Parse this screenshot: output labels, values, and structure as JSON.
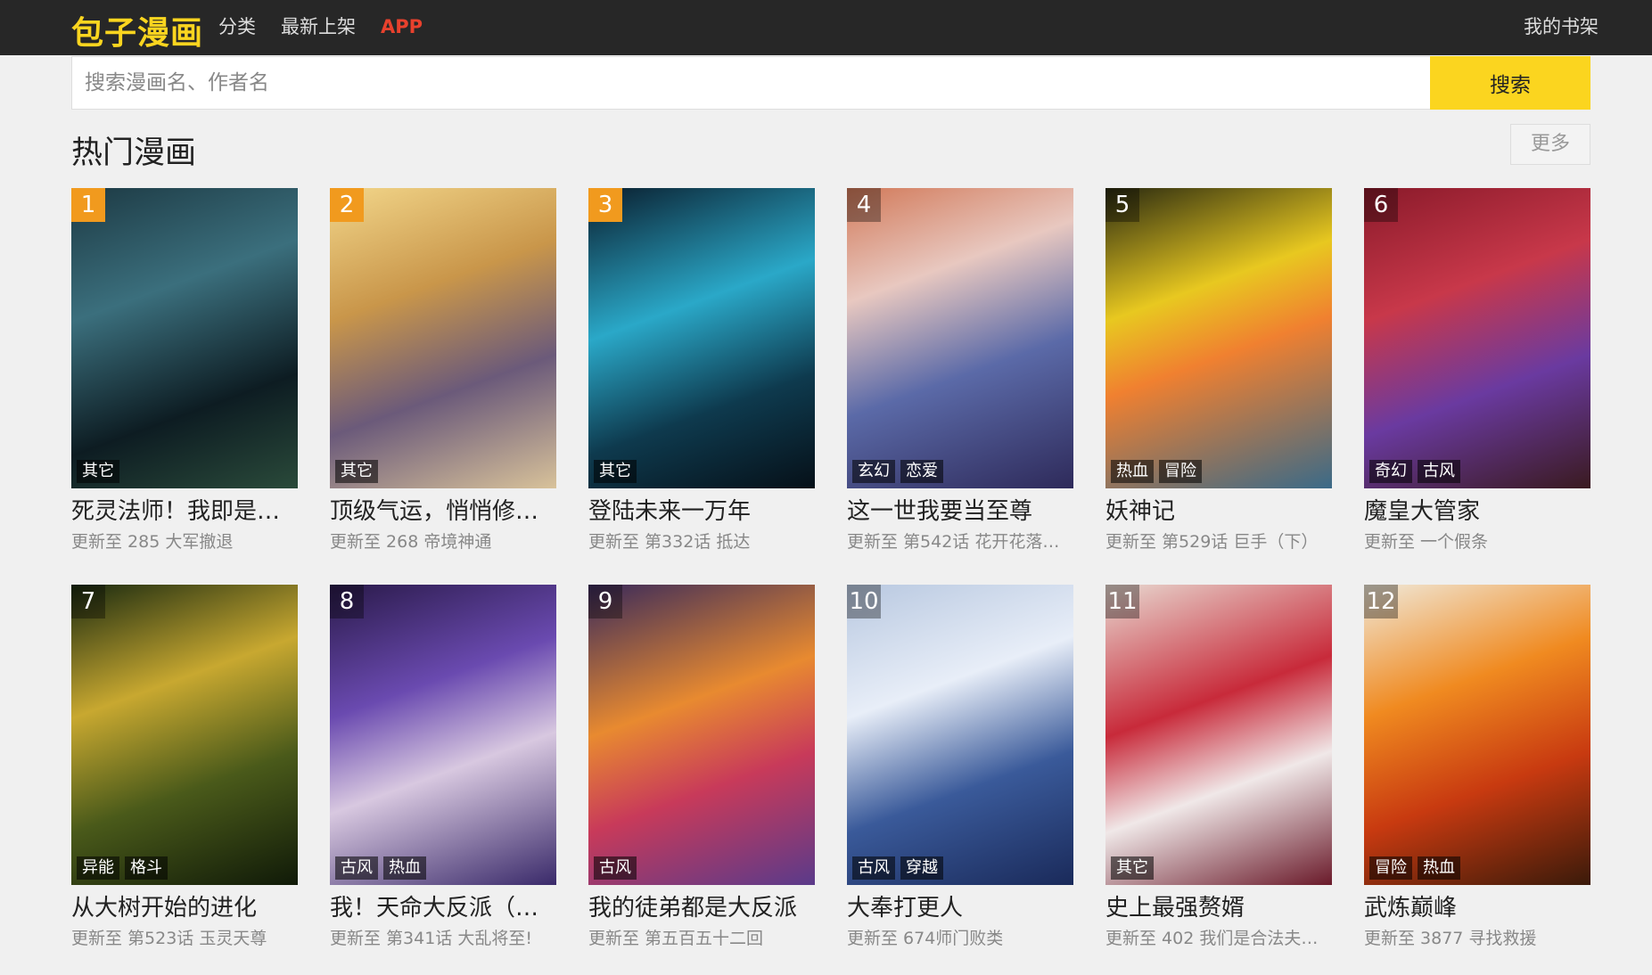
{
  "header": {
    "logo": "包子漫画",
    "nav": [
      "分类",
      "最新上架",
      "APP"
    ],
    "shelf": "我的书架"
  },
  "search": {
    "placeholder": "搜索漫画名、作者名",
    "button": "搜索"
  },
  "section": {
    "title": "热门漫画",
    "more": "更多"
  },
  "colors": {
    "brand": "#fbd51f",
    "topbar": "#272727",
    "app": "#e8412d",
    "rank_top": "#f19a1e"
  },
  "comics": [
    {
      "rank": "1",
      "title": "死灵法师！我即是…",
      "update": "更新至 285 大军撤退",
      "tags": [
        "其它"
      ],
      "bg": "linear-gradient(160deg,#1d3a44 0%,#3b6f7d 35%,#0d1c22 70%,#2a4a3a 100%)"
    },
    {
      "rank": "2",
      "title": "顶级气运，悄悄修…",
      "update": "更新至 268 帝境神通",
      "tags": [
        "其它"
      ],
      "bg": "linear-gradient(160deg,#f2d68a 0%,#c9964a 35%,#6b5a7a 65%,#d8c29a 100%)"
    },
    {
      "rank": "3",
      "title": "登陆未来一万年",
      "update": "更新至 第332话 抵达",
      "tags": [
        "其它"
      ],
      "bg": "linear-gradient(160deg,#0a1e2e 0%,#2aa8c8 40%,#0e3a4e 70%,#061018 100%)"
    },
    {
      "rank": "4",
      "title": "这一世我要当至尊",
      "update": "更新至 第542话 花开花落花…",
      "tags": [
        "玄幻",
        "恋爱"
      ],
      "bg": "linear-gradient(160deg,#d27a5a 0%,#e8c8c0 30%,#5b6aa8 60%,#2e2a5a 100%)"
    },
    {
      "rank": "5",
      "title": "妖神记",
      "update": "更新至 第529话 巨手（下）",
      "tags": [
        "热血",
        "冒险"
      ],
      "bg": "linear-gradient(160deg,#2a2a10 0%,#e8c820 35%,#f08030 55%,#3a6a88 100%)"
    },
    {
      "rank": "6",
      "title": "魔皇大管家",
      "update": "更新至 一个假条",
      "tags": [
        "奇幻",
        "古风"
      ],
      "bg": "linear-gradient(160deg,#8a1a2a 0%,#c8384a 35%,#6a3aa0 65%,#3a1a20 100%)"
    },
    {
      "rank": "7",
      "title": "从大树开始的进化",
      "update": "更新至 第523话 玉灵天尊",
      "tags": [
        "异能",
        "格斗"
      ],
      "bg": "linear-gradient(160deg,#1a2a10 0%,#c8a830 35%,#4a5a1a 65%,#101a08 100%)"
    },
    {
      "rank": "8",
      "title": "我！天命大反派（…",
      "update": "更新至 第341话 大乱将至!",
      "tags": [
        "古风",
        "热血"
      ],
      "bg": "linear-gradient(160deg,#2a1a4a 0%,#6a4ab0 35%,#d8c8e0 60%,#3a2a6a 100%)"
    },
    {
      "rank": "9",
      "title": "我的徒弟都是大反派",
      "update": "更新至 第五百五十二回",
      "tags": [
        "古风"
      ],
      "bg": "linear-gradient(160deg,#3a2a5a 0%,#e88a30 40%,#c83a5a 65%,#5a3a8a 100%)"
    },
    {
      "rank": "10",
      "title": "大奉打更人",
      "update": "更新至 674师门败类",
      "tags": [
        "古风",
        "穿越"
      ],
      "bg": "linear-gradient(160deg,#b8c8e0 0%,#e8eef8 35%,#3a5a9a 65%,#1a2a5a 100%)"
    },
    {
      "rank": "11",
      "title": "史上最强赘婿",
      "update": "更新至 402 我们是合法夫妻…",
      "tags": [
        "其它"
      ],
      "bg": "linear-gradient(160deg,#e8d8d0 0%,#c82a3a 40%,#f0e8e8 65%,#6a1a2a 100%)"
    },
    {
      "rank": "12",
      "title": "武炼巅峰",
      "update": "更新至 3877 寻找救援",
      "tags": [
        "冒险",
        "热血"
      ],
      "bg": "linear-gradient(160deg,#f0e8d8 0%,#f08a20 35%,#c83a10 65%,#3a1a0a 100%)"
    }
  ]
}
